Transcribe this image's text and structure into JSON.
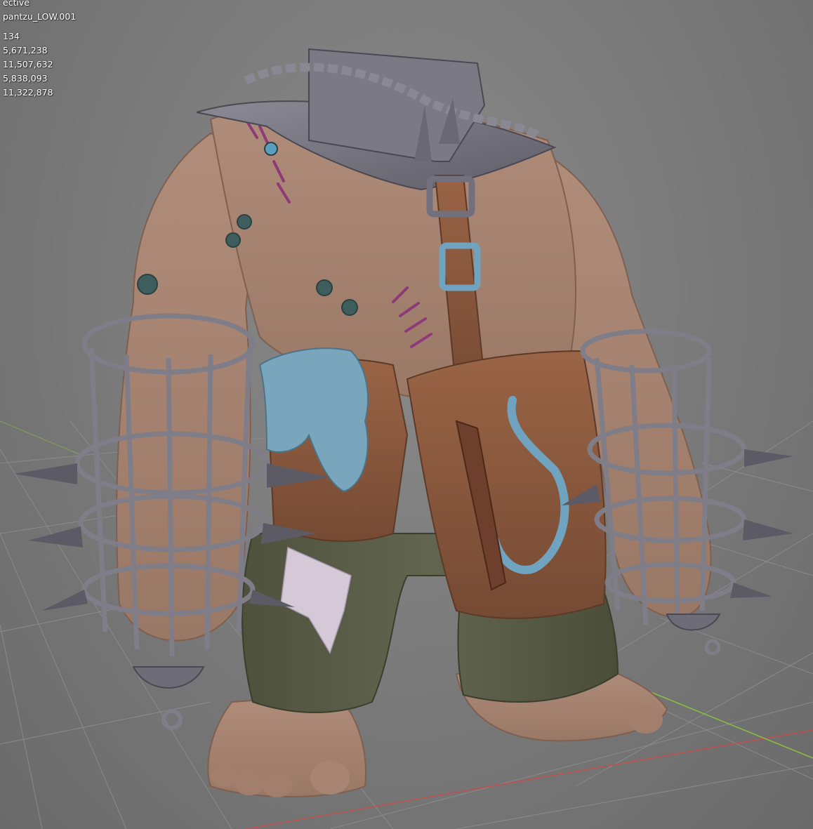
{
  "viewport": {
    "view_label": "ective",
    "object_name": "pantzu_LOW.001",
    "stats": [
      "134",
      "5,671,238",
      "11,507,632",
      "5,838,093",
      "11,322,878"
    ]
  },
  "colors": {
    "background": "#7c7c7c",
    "grid_line": "#8f8f8f",
    "axis_x": "#c0504e",
    "axis_y": "#8bbf3f",
    "skin": "#a98673",
    "metal": "#7f7d88",
    "leather": "#8a5a3e",
    "pants": "#575a43",
    "accent_blue": "#6fa3bf"
  }
}
